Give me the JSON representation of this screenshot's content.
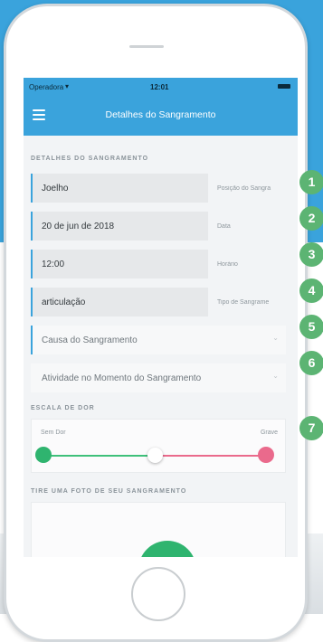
{
  "status_bar": {
    "carrier": "Operadora",
    "wifi_icon": "wifi-icon",
    "time": "12:01"
  },
  "nav": {
    "title": "Detalhes do Sangramento",
    "menu_icon": "hamburger-menu-icon"
  },
  "details": {
    "section_title": "DETALHES DO SANGRAMENTO",
    "fields": [
      {
        "value": "Joelho",
        "label": "Posição do Sangra"
      },
      {
        "value": "20 de jun de 2018",
        "label": "Data"
      },
      {
        "value": "12:00",
        "label": "Horário"
      },
      {
        "value": "articulação",
        "label": "Tipo de Sangrame"
      }
    ],
    "selects": [
      {
        "placeholder": "Causa do Sangramento"
      },
      {
        "placeholder": "Atividade no Momento do Sangramento"
      }
    ]
  },
  "pain_scale": {
    "section_title": "ESCALA DE DOR",
    "min_label": "Sem Dor",
    "max_label": "Grave",
    "value": 0.5
  },
  "photo": {
    "section_title": "TIRE UMA FOTO DE SEU SANGRAMENTO"
  },
  "badges": [
    "1",
    "2",
    "3",
    "4",
    "5",
    "6",
    "7"
  ],
  "colors": {
    "primary": "#3aa3dc",
    "green": "#2fb46f",
    "pink": "#ea6a8c",
    "badge": "#5cb473"
  }
}
